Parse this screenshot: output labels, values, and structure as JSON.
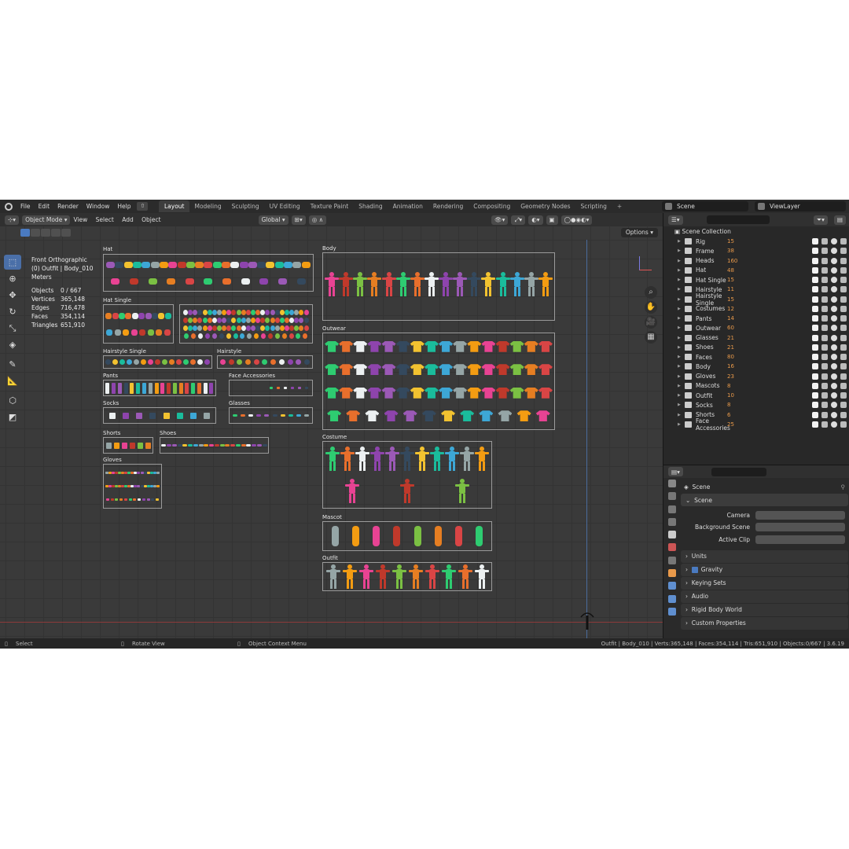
{
  "topbar": {
    "menus": [
      "File",
      "Edit",
      "Render",
      "Window",
      "Help"
    ],
    "tabs": [
      "Layout",
      "Modeling",
      "Sculpting",
      "UV Editing",
      "Texture Paint",
      "Shading",
      "Animation",
      "Rendering",
      "Compositing",
      "Geometry Nodes",
      "Scripting"
    ],
    "active_tab": "Layout",
    "add_tab": "+",
    "scene": "Scene",
    "view_layer": "ViewLayer"
  },
  "viewport": {
    "mode": "Object Mode",
    "menus": [
      "View",
      "Select",
      "Add",
      "Object"
    ],
    "orientation": "Global",
    "options": "Options",
    "overlay": {
      "view_name": "Front Orthographic",
      "context": "(0) Outfit | Body_010",
      "units": "Meters",
      "stats": [
        {
          "label": "Objects",
          "value": "0 / 667"
        },
        {
          "label": "Vertices",
          "value": "365,148"
        },
        {
          "label": "Edges",
          "value": "716,478"
        },
        {
          "label": "Faces",
          "value": "354,114"
        },
        {
          "label": "Triangles",
          "value": "651,910"
        }
      ]
    },
    "groups": {
      "hat": "Hat",
      "hat_single": "Hat Single",
      "hairstyle_single": "Hairstyle Single",
      "hairstyle": "Hairstyle",
      "pants": "Pants",
      "face_accessories": "Face Accessories",
      "socks": "Socks",
      "glasses": "Glasses",
      "shorts": "Shorts",
      "shoes": "Shoes",
      "gloves": "Gloves",
      "body": "Body",
      "outwear": "Outwear",
      "costume": "Costume",
      "mascot": "Mascot",
      "outfit": "Outfit"
    }
  },
  "statusbar": {
    "left": "Select",
    "middle": "Rotate View",
    "right_menu": "Object Context Menu",
    "info": "Outfit | Body_010 | Verts:365,148 | Faces:354,114 | Tris:651,910 | Objects:0/667 | 3.6.19"
  },
  "outliner": {
    "root": "Scene Collection",
    "items": [
      {
        "name": "Rig",
        "count": "15"
      },
      {
        "name": "Frame",
        "count": "38"
      },
      {
        "name": "Heads",
        "count": "160"
      },
      {
        "name": "Hat",
        "count": "48"
      },
      {
        "name": "Hat Single",
        "count": "15"
      },
      {
        "name": "Hairstyle",
        "count": "11"
      },
      {
        "name": "Hairstyle Single",
        "count": "15"
      },
      {
        "name": "Costumes",
        "count": "12"
      },
      {
        "name": "Pants",
        "count": "14"
      },
      {
        "name": "Outwear",
        "count": "60"
      },
      {
        "name": "Glasses",
        "count": "21"
      },
      {
        "name": "Shoes",
        "count": "21"
      },
      {
        "name": "Faces",
        "count": "80"
      },
      {
        "name": "Body",
        "count": "16"
      },
      {
        "name": "Gloves",
        "count": "23"
      },
      {
        "name": "Mascots",
        "count": "8"
      },
      {
        "name": "Outfit",
        "count": "10"
      },
      {
        "name": "Socks",
        "count": "8"
      },
      {
        "name": "Shorts",
        "count": "6"
      },
      {
        "name": "Face Accessories",
        "count": "25"
      }
    ]
  },
  "properties": {
    "title": "Scene",
    "section": "Scene",
    "rows": [
      {
        "label": "Camera"
      },
      {
        "label": "Background Scene"
      },
      {
        "label": "Active Clip"
      }
    ],
    "panels": [
      "Units",
      "Gravity",
      "Keying Sets",
      "Audio",
      "Rigid Body World",
      "Custom Properties"
    ]
  },
  "colors": {
    "accent": "#4a7ac0",
    "collection_badge": "#e8994a",
    "grid_bg": "#3a3a3a",
    "header": "#2b2b2b"
  }
}
